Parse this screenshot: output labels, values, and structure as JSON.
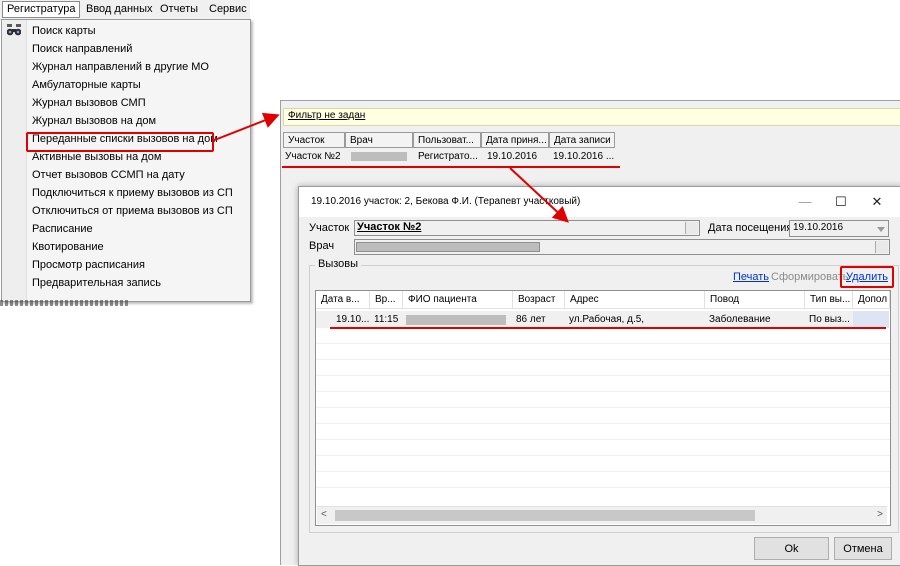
{
  "menu": {
    "items": [
      {
        "label": "Регистратура",
        "active": true
      },
      {
        "label": "Ввод данных"
      },
      {
        "label": "Отчеты"
      },
      {
        "label": "Сервис"
      }
    ],
    "dropdown": [
      "Поиск карты",
      "Поиск направлений",
      "Журнал направлений в другие МО",
      "Амбулаторные карты",
      "Журнал вызовов СМП",
      "Журнал вызовов на дом",
      "Переданные списки вызовов на дом",
      "Активные вызовы на дом",
      "Отчет вызовов ССМП на дату",
      "Подключиться к приему вызовов из СП",
      "Отключиться от приема вызовов из СП",
      "Расписание",
      "Квотирование",
      "Просмотр расписания",
      "Предварительная запись"
    ],
    "highlighted_index": 6
  },
  "list": {
    "filter": "Фильтр не задан",
    "columns": [
      "Участок",
      "Врач",
      "Пользоват...",
      "Дата приня...",
      "Дата записи"
    ],
    "rows": [
      {
        "uchastok": "Участок №2",
        "vrach": "",
        "user": "Регистрато...",
        "date_accepted": "19.10.2016",
        "date_record": "19.10.2016 ..."
      }
    ]
  },
  "dialog": {
    "title": "19.10.2016 участок: 2, Бекова Ф.И. (Терапевт участковый)",
    "minimize": "—",
    "maximize": "☐",
    "close": "✕",
    "uchastok_label": "Участок",
    "uchastok_value": "Участок №2",
    "date_label": "Дата посещения",
    "date_value": "19.10.2016",
    "vrach_label": "Врач",
    "group_label": "Вызовы",
    "actions": {
      "print": "Печать",
      "form": "Сформировать",
      "delete": "Удалить"
    },
    "columns": [
      "Дата в...",
      "Вр...",
      "ФИО пациента",
      "Возраст",
      "Адрес",
      "Повод",
      "Тип вы...",
      "Допол"
    ],
    "rows": [
      {
        "date": "19.10...",
        "time": "11:15",
        "fio": "",
        "age": "86 лет",
        "address": "ул.Рабочая, д.5,",
        "reason": "Заболевание",
        "type": "По выз..."
      }
    ],
    "ok": "Ok",
    "cancel": "Отмена"
  },
  "colors": {
    "annotation_red": "#e00000",
    "link_blue": "#0033cc",
    "filter_yellow": "#ffffe1"
  }
}
